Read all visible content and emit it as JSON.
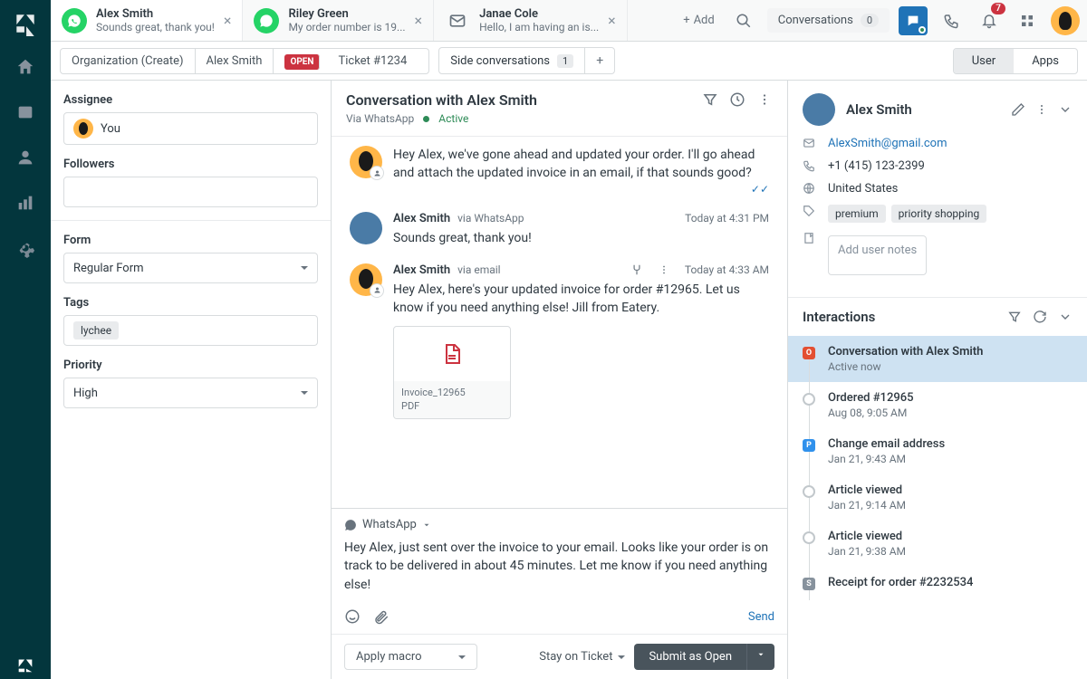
{
  "topbar": {
    "tabs": [
      {
        "title": "Alex Smith",
        "sub": "Sounds great, thank you!",
        "channel": "whatsapp"
      },
      {
        "title": "Riley Green",
        "sub": "My order number is 19...",
        "channel": "whatsapp"
      },
      {
        "title": "Janae Cole",
        "sub": "Hello, I am having an is...",
        "channel": "email"
      }
    ],
    "add_label": "Add",
    "conversations_label": "Conversations",
    "conversations_count": "0",
    "notif_count": "7"
  },
  "crumb": {
    "org": "Organization (Create)",
    "name": "Alex Smith",
    "status": "OPEN",
    "ticket": "Ticket #1234",
    "sideconv": "Side conversations",
    "sideconv_count": "1",
    "toggle_user": "User",
    "toggle_apps": "Apps"
  },
  "left": {
    "assignee_label": "Assignee",
    "assignee_value": "You",
    "followers_label": "Followers",
    "form_label": "Form",
    "form_value": "Regular Form",
    "tags_label": "Tags",
    "tag": "lychee",
    "priority_label": "Priority",
    "priority_value": "High"
  },
  "conv": {
    "title": "Conversation with Alex Smith",
    "via": "Via WhatsApp",
    "status": "Active",
    "msgs": [
      {
        "author": "",
        "via": "",
        "time": "",
        "text": "Hey Alex, we've gone ahead and updated your order. I'll go ahead and attach the updated invoice in an email, if that sounds good?",
        "agent": true,
        "check": true
      },
      {
        "author": "Alex Smith",
        "via": "via WhatsApp",
        "time": "Today at 4:31 PM",
        "text": "Sounds great, thank you!",
        "agent": false
      },
      {
        "author": "Alex Smith",
        "via": "via email",
        "time": "Today at 4:33 AM",
        "text": "Hey Alex, here's your updated invoice for order #12965. Let us know if you need anything else! Jill from Eatery.",
        "agent": true,
        "attach": {
          "name": "Invoice_12965",
          "type": "PDF"
        },
        "fork": true
      }
    ],
    "composer_channel": "WhatsApp",
    "composer_text": "Hey Alex, just sent over the invoice to your email. Looks like your order is on track to be delivered in about 45 minutes. Let me know if you need anything else!",
    "send": "Send",
    "macro": "Apply macro",
    "stay": "Stay on Ticket",
    "submit": "Submit as Open"
  },
  "profile": {
    "name": "Alex Smith",
    "email": "AlexSmith@gmail.com",
    "phone": "+1 (415) 123-2399",
    "location": "United States",
    "tags": [
      "premium",
      "priority shopping"
    ],
    "notes_placeholder": "Add user notes"
  },
  "interactions": {
    "title": "Interactions",
    "items": [
      {
        "title": "Conversation with Alex Smith",
        "sub": "Active now",
        "kind": "o",
        "active": true
      },
      {
        "title": "Ordered #12965",
        "sub": "Aug 08, 9:05 AM",
        "kind": ""
      },
      {
        "title": "Change email address",
        "sub": "Jan 21, 9:43 AM",
        "kind": "p"
      },
      {
        "title": "Article viewed",
        "sub": "Jan 21, 9:14 AM",
        "kind": ""
      },
      {
        "title": "Article viewed",
        "sub": "Jan 21, 9:38 AM",
        "kind": ""
      },
      {
        "title": "Receipt for order #2232534",
        "sub": "",
        "kind": "s"
      }
    ]
  }
}
